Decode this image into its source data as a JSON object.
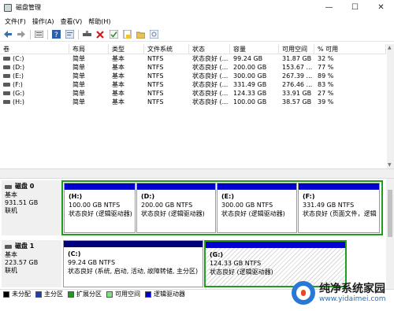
{
  "window": {
    "title": "磁盘管理",
    "minimize_glyph": "—",
    "maximize_glyph": "☐",
    "close_glyph": "✕"
  },
  "menu": [
    "文件(F)",
    "操作(A)",
    "查看(V)",
    "帮助(H)"
  ],
  "toolbar": {
    "icons": [
      "back-arrow-icon",
      "forward-arrow-icon",
      "list-view-icon",
      "help-icon",
      "properties-icon",
      "connect-icon",
      "delete-x-icon",
      "check-icon",
      "new-volume-icon",
      "folder-icon",
      "refresh-icon"
    ]
  },
  "volume_table": {
    "columns": [
      "卷",
      "布局",
      "类型",
      "文件系统",
      "状态",
      "容量",
      "可用空间",
      "% 可用"
    ],
    "rows": [
      {
        "vol": "(C:)",
        "layout": "简单",
        "type": "基本",
        "fs": "NTFS",
        "status": "状态良好 (...",
        "capacity": "99.24 GB",
        "free": "31.87 GB",
        "pct": "32 %"
      },
      {
        "vol": "(D:)",
        "layout": "简单",
        "type": "基本",
        "fs": "NTFS",
        "status": "状态良好 (...",
        "capacity": "200.00 GB",
        "free": "153.67 ...",
        "pct": "77 %"
      },
      {
        "vol": "(E:)",
        "layout": "简单",
        "type": "基本",
        "fs": "NTFS",
        "status": "状态良好 (...",
        "capacity": "300.00 GB",
        "free": "267.39 ...",
        "pct": "89 %"
      },
      {
        "vol": "(F:)",
        "layout": "简单",
        "type": "基本",
        "fs": "NTFS",
        "status": "状态良好 (...",
        "capacity": "331.49 GB",
        "free": "276.46 ...",
        "pct": "83 %"
      },
      {
        "vol": "(G:)",
        "layout": "简单",
        "type": "基本",
        "fs": "NTFS",
        "status": "状态良好 (...",
        "capacity": "124.33 GB",
        "free": "33.91 GB",
        "pct": "27 %"
      },
      {
        "vol": "(H:)",
        "layout": "简单",
        "type": "基本",
        "fs": "NTFS",
        "status": "状态良好 (...",
        "capacity": "100.00 GB",
        "free": "38.57 GB",
        "pct": "39 %"
      }
    ]
  },
  "disks": [
    {
      "name": "磁盘 0",
      "type": "基本",
      "size": "931.51 GB",
      "state": "联机",
      "partitions": [
        {
          "label": "(H:)",
          "size": "100.00 GB NTFS",
          "status": "状态良好 (逻辑驱动器)"
        },
        {
          "label": "(D:)",
          "size": "200.00 GB NTFS",
          "status": "状态良好 (逻辑驱动器)"
        },
        {
          "label": "(E:)",
          "size": "300.00 GB NTFS",
          "status": "状态良好 (逻辑驱动器)"
        },
        {
          "label": "(F:)",
          "size": "331.49 GB NTFS",
          "status": "状态良好 (页面文件，逻辑"
        }
      ]
    },
    {
      "name": "磁盘 1",
      "type": "基本",
      "size": "223.57 GB",
      "state": "联机",
      "partitions": [
        {
          "label": "(C:)",
          "size": "99.24 GB NTFS",
          "status": "状态良好 (系统, 启动, 活动, 故障转储, 主分区)"
        },
        {
          "label": "(G:)",
          "size": "124.33 GB NTFS",
          "status": "状态良好 (逻辑驱动器)"
        }
      ]
    }
  ],
  "legend": [
    {
      "label": "未分配",
      "color": "#000000"
    },
    {
      "label": "主分区",
      "color": "#1f3fae"
    },
    {
      "label": "扩展分区",
      "color": "#1f9d1f"
    },
    {
      "label": "可用空间",
      "color": "#7fe07f"
    },
    {
      "label": "逻辑驱动器",
      "color": "#0000d0"
    }
  ],
  "colors": {
    "primary_partition_bar": "#00007b",
    "logical_drive_bar": "#0000d0",
    "extended_frame": "#1f9d1f"
  },
  "watermark": {
    "title": "纯净系统家园",
    "url": "www.yidaimei.com"
  }
}
